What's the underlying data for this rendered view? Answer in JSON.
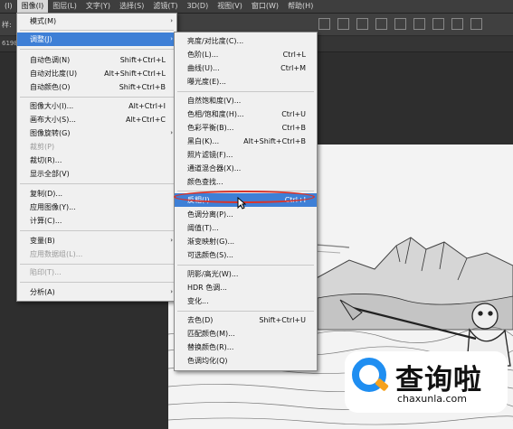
{
  "menubar": {
    "items": [
      {
        "label": "(I)"
      },
      {
        "label": "图像(I)"
      },
      {
        "label": "图层(L)"
      },
      {
        "label": "文字(Y)"
      },
      {
        "label": "选择(S)"
      },
      {
        "label": "滤镜(T)"
      },
      {
        "label": "3D(D)"
      },
      {
        "label": "视图(V)"
      },
      {
        "label": "窗口(W)"
      },
      {
        "label": "帮助(H)"
      }
    ]
  },
  "optbar": {
    "label": "样:"
  },
  "docbar": {
    "text": "6198"
  },
  "image_menu": {
    "items": [
      {
        "label": "模式(M)",
        "arrow": "›"
      },
      {
        "label": "调整(J)",
        "arrow": "›"
      },
      {
        "label": "自动色调(N)",
        "shortcut": "Shift+Ctrl+L"
      },
      {
        "label": "自动对比度(U)",
        "shortcut": "Alt+Shift+Ctrl+L"
      },
      {
        "label": "自动颜色(O)",
        "shortcut": "Shift+Ctrl+B"
      },
      {
        "label": "图像大小(I)...",
        "shortcut": "Alt+Ctrl+I"
      },
      {
        "label": "画布大小(S)...",
        "shortcut": "Alt+Ctrl+C"
      },
      {
        "label": "图像旋转(G)",
        "arrow": "›"
      },
      {
        "label": "裁剪(P)"
      },
      {
        "label": "裁切(R)..."
      },
      {
        "label": "显示全部(V)"
      },
      {
        "label": "复制(D)..."
      },
      {
        "label": "应用图像(Y)..."
      },
      {
        "label": "计算(C)..."
      },
      {
        "label": "变量(B)",
        "arrow": "›"
      },
      {
        "label": "应用数据组(L)..."
      },
      {
        "label": "陷印(T)..."
      },
      {
        "label": "分析(A)",
        "arrow": "›"
      }
    ]
  },
  "adjust_menu": {
    "items": [
      {
        "label": "亮度/对比度(C)..."
      },
      {
        "label": "色阶(L)...",
        "shortcut": "Ctrl+L"
      },
      {
        "label": "曲线(U)...",
        "shortcut": "Ctrl+M"
      },
      {
        "label": "曝光度(E)..."
      },
      {
        "label": "自然饱和度(V)..."
      },
      {
        "label": "色相/饱和度(H)...",
        "shortcut": "Ctrl+U"
      },
      {
        "label": "色彩平衡(B)...",
        "shortcut": "Ctrl+B"
      },
      {
        "label": "黑白(K)...",
        "shortcut": "Alt+Shift+Ctrl+B"
      },
      {
        "label": "照片滤镜(F)..."
      },
      {
        "label": "通道混合器(X)..."
      },
      {
        "label": "颜色查找..."
      },
      {
        "label": "反相(I)",
        "shortcut": "Ctrl+I"
      },
      {
        "label": "色调分离(P)..."
      },
      {
        "label": "阈值(T)..."
      },
      {
        "label": "渐变映射(G)..."
      },
      {
        "label": "可选颜色(S)..."
      },
      {
        "label": "阴影/高光(W)..."
      },
      {
        "label": "HDR 色调..."
      },
      {
        "label": "变化..."
      },
      {
        "label": "去色(D)",
        "shortcut": "Shift+Ctrl+U"
      },
      {
        "label": "匹配颜色(M)..."
      },
      {
        "label": "替换颜色(R)..."
      },
      {
        "label": "色调均化(Q)"
      }
    ]
  },
  "watermark": {
    "brand": "查询啦",
    "url": "chaxunla.com"
  },
  "colors": {
    "highlight": "#3e7fd6",
    "annotation": "#d9342b",
    "brand_blue": "#1f8ef1",
    "brand_orange": "#f6a21e"
  }
}
